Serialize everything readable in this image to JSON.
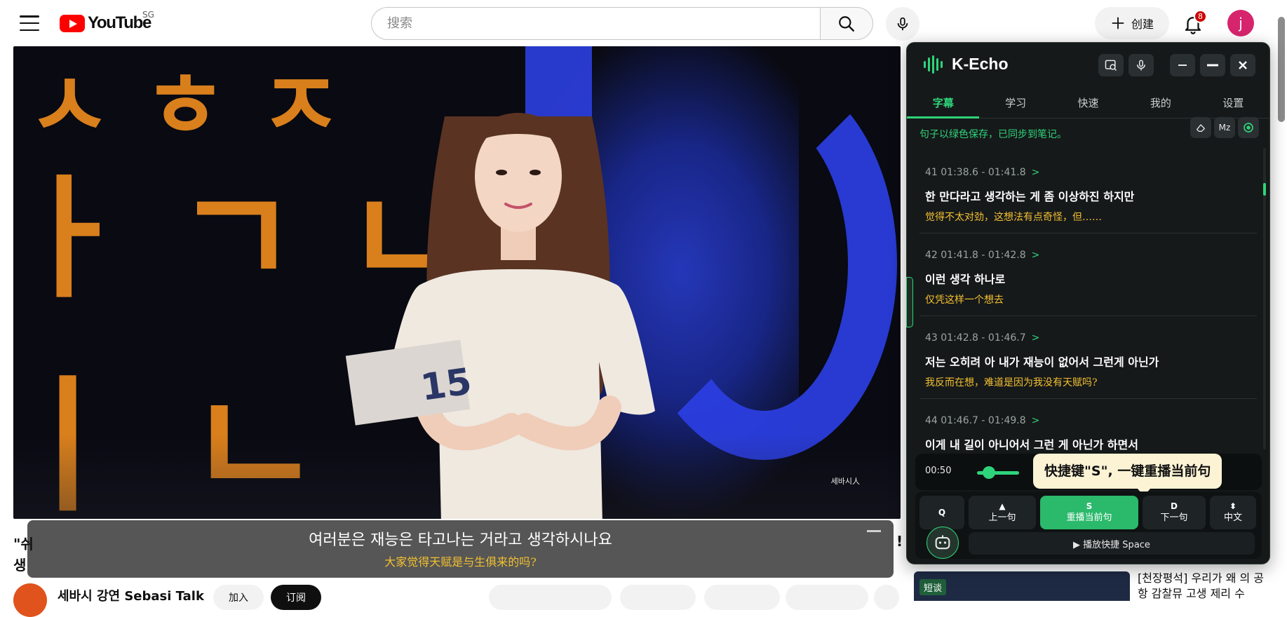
{
  "youtube": {
    "region": "SG",
    "logo_text": "YouTube",
    "search_placeholder": "搜索",
    "create_label": "创建",
    "notification_count": "8",
    "avatar_letter": "j"
  },
  "video": {
    "watermark": "세바시人",
    "caption": {
      "korean": "여러분은 재능은 타고나는 거라고 생각하시나요",
      "chinese": "大家觉得天赋是与生俱来的吗?"
    },
    "title_fragment_start": "\"쉬",
    "title_fragment_second": "생",
    "title_fragment_end": "!",
    "channel_name": "세바시 강연 Sebasi Talk",
    "join_label": "加入",
    "subscribe_label": "订阅"
  },
  "recommendation": {
    "tag": "短谈",
    "title": "[천장평석] 우리가 왜 의 공항 감찰뮤 고생 제리 수"
  },
  "kecho": {
    "brand": "K-Echo",
    "tabs": [
      {
        "label": "字幕",
        "active": true
      },
      {
        "label": "学习",
        "active": false
      },
      {
        "label": "快速",
        "active": false
      },
      {
        "label": "我的",
        "active": false
      },
      {
        "label": "设置",
        "active": false
      }
    ],
    "notice": "句子以绿色保存，已同步到笔记。",
    "tool_mz": "Mz",
    "subtitles": [
      {
        "meta": "41 01:38.6 - 01:41.8",
        "korean": "한 만다라고 생각하는 게 좀 이상하진 하지만",
        "chinese": "觉得不太对劲，这想法有点奇怪，但……"
      },
      {
        "meta": "42 01:41.8 - 01:42.8",
        "korean": "이런 생각 하나로",
        "chinese": "仅凭这样一个想去"
      },
      {
        "meta": "43 01:42.8 - 01:46.7",
        "korean": "저는 오히려 아 내가 재능이 없어서 그런게 아닌가",
        "chinese": "我反而在想，难道是因为我没有天赋吗?"
      },
      {
        "meta": "44 01:46.7 - 01:49.8",
        "korean": "이게 내 길이 아니어서 그런 게 아닌가 하면서",
        "chinese": ""
      }
    ],
    "player_time": "00:50",
    "tooltip": "快捷键\"S\", 一键重播当前句",
    "controls": [
      {
        "key": "Q",
        "label": ""
      },
      {
        "key": "▲",
        "label": "上一句"
      },
      {
        "key": "S",
        "label": "重播当前句"
      },
      {
        "key": "D",
        "label": "下一句"
      },
      {
        "key": "⬍",
        "label": "中文"
      }
    ],
    "space_label": "▶ 播放快捷 Space"
  }
}
